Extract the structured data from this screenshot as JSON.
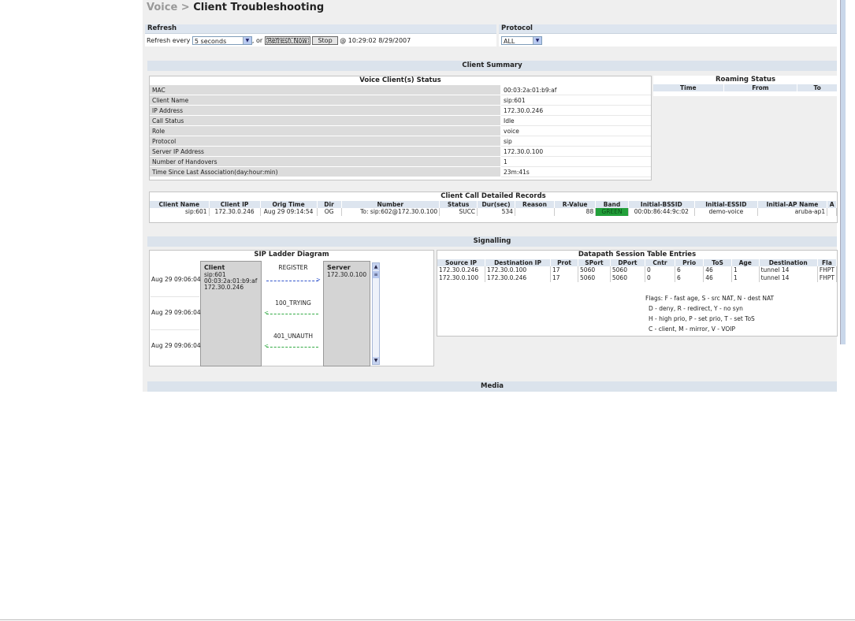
{
  "breadcrumb": {
    "parent": "Voice",
    "separator": ">",
    "current": "Client Troubleshooting"
  },
  "refresh": {
    "heading": "Refresh",
    "prefix": "Refresh every",
    "interval": "5 seconds",
    "or_text": ", or",
    "refresh_now": "Refresh Now",
    "stop": "Stop",
    "timestamp": "@ 10:29:02 8/29/2007"
  },
  "protocol": {
    "heading": "Protocol",
    "value": "ALL"
  },
  "client_summary": {
    "section_title": "Client Summary",
    "voice_status": {
      "title": "Voice Client(s) Status",
      "rows": [
        {
          "key": "MAC",
          "value": "00:03:2a:01:b9:af"
        },
        {
          "key": "Client Name",
          "value": "sip:601"
        },
        {
          "key": "IP Address",
          "value": "172.30.0.246"
        },
        {
          "key": "Call Status",
          "value": "Idle"
        },
        {
          "key": "Role",
          "value": "voice"
        },
        {
          "key": "Protocol",
          "value": "sip"
        },
        {
          "key": "Server IP Address",
          "value": "172.30.0.100"
        },
        {
          "key": "Number of Handovers",
          "value": "1"
        },
        {
          "key": "Time Since Last Association(day:hour:min)",
          "value": "23m:41s"
        }
      ]
    },
    "roaming": {
      "title": "Roaming Status",
      "columns": [
        "Time",
        "From",
        "To"
      ]
    }
  },
  "cdr": {
    "title": "Client Call Detailed Records",
    "columns": [
      "Client Name",
      "Client IP",
      "Orig Time",
      "Dir",
      "Number",
      "Status",
      "Dur(sec)",
      "Reason",
      "R-Value",
      "Band",
      "Initial-BSSID",
      "Initial-ESSID",
      "Initial-AP Name",
      "A"
    ],
    "row": [
      "sip:601",
      "172.30.0.246",
      "Aug 29 09:14:54",
      "OG",
      "To: sip:602@172.30.0.100",
      "SUCC",
      "534",
      "",
      "88",
      "GREEN",
      "00:0b:86:44:9c:02",
      "demo-voice",
      "aruba-ap1",
      ""
    ]
  },
  "signalling": {
    "section_title": "Signalling",
    "sip_ladder": {
      "title": "SIP Ladder Diagram",
      "client_label": "Client",
      "client_lines": [
        "sip:601",
        "00:03:2a:01:b9:af",
        "172.30.0.246"
      ],
      "server_label": "Server",
      "server_ip": "172.30.0.100",
      "events": [
        {
          "time": "Aug 29 09:06:04",
          "message": "REGISTER",
          "direction": "to-server"
        },
        {
          "time": "Aug 29 09:06:04",
          "message": "100_TRYING",
          "direction": "to-client"
        },
        {
          "time": "Aug 29 09:06:04",
          "message": "401_UNAUTH",
          "direction": "to-client"
        }
      ]
    },
    "datapath": {
      "title": "Datapath Session Table Entries",
      "columns": [
        "Source IP",
        "Destination IP",
        "Prot",
        "SPort",
        "DPort",
        "Cntr",
        "Prio",
        "ToS",
        "Age",
        "Destination",
        "Fla"
      ],
      "rows": [
        [
          "172.30.0.246",
          "172.30.0.100",
          "17",
          "5060",
          "5060",
          "0",
          "6",
          "46",
          "1",
          "tunnel 14",
          "FHPT"
        ],
        [
          "172.30.0.100",
          "172.30.0.246",
          "17",
          "5060",
          "5060",
          "0",
          "6",
          "46",
          "1",
          "tunnel 14",
          "FHPT"
        ]
      ],
      "flags": [
        "Flags: F - fast age, S - src NAT, N - dest NAT",
        "D - deny, R - redirect, Y - no syn",
        "H - high prio, P - set prio, T - set ToS",
        "C - client, M - mirror, V - VOIP"
      ]
    }
  },
  "media": {
    "section_title": "Media"
  },
  "colors": {
    "band_green": "#22a03a",
    "section_bar": "#dbe3ec",
    "frame_bg": "#efefef"
  }
}
